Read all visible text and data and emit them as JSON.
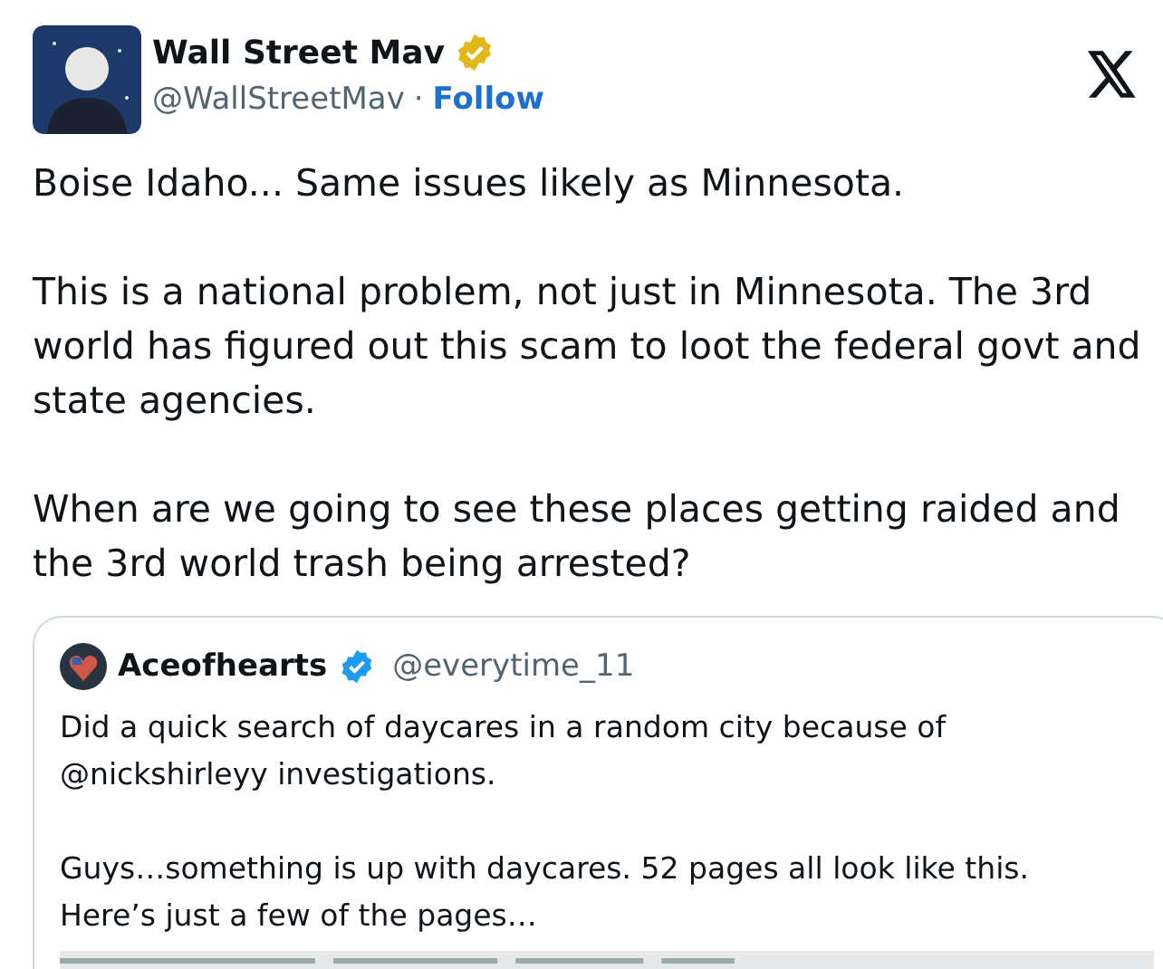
{
  "author": {
    "name": "Wall Street Mav",
    "verified": true,
    "handle": "@WallStreetMav",
    "separator": "·",
    "follow": "Follow"
  },
  "body": [
    "Boise Idaho... Same issues likely as Minnesota.",
    "This is a national problem, not just in Minnesota. The 3rd world has figured out this scam to loot the federal govt and state agencies.",
    "When are we going to see these places getting raided and the 3rd world trash being arrested?"
  ],
  "quote": {
    "name": "Aceofhearts",
    "verified": true,
    "handle": "@everytime_11",
    "body": [
      "Did a quick search of daycares in a random city because of @nickshirleyy investigations.",
      "Guys…something is up with daycares. 52 pages all look like this. Here’s just a few of the pages…"
    ],
    "media": {
      "kind": "picture"
    }
  }
}
